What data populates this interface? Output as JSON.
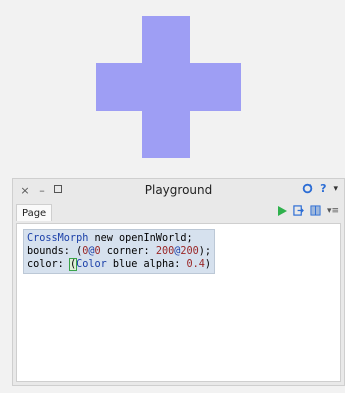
{
  "cross": {
    "color": "#9e9ef4"
  },
  "window": {
    "title": "Playground",
    "controls": {
      "close": "×",
      "minimize": "–"
    },
    "help": "?",
    "menu_arrow": "▾",
    "tab_label": "Page",
    "more_icon": "▾≡"
  },
  "code": {
    "line1": {
      "class_name": "CrossMorph",
      "rest": " new openInWorld;"
    },
    "line2": {
      "a": "bounds: (",
      "n1": "0",
      "at1": "@",
      "n2": "0",
      "b": " corner: ",
      "n3": "200",
      "at2": "@",
      "n4": "200",
      "c": ");"
    },
    "line3": {
      "a": "color: ",
      "paren": "(",
      "class_name": "Color",
      "b": " blue alpha: ",
      "n": "0.4",
      "c": ")"
    }
  },
  "colors": {
    "play": "#2fb14d",
    "refresh": "#2c6dd5",
    "selection": "#d6e1ee"
  }
}
